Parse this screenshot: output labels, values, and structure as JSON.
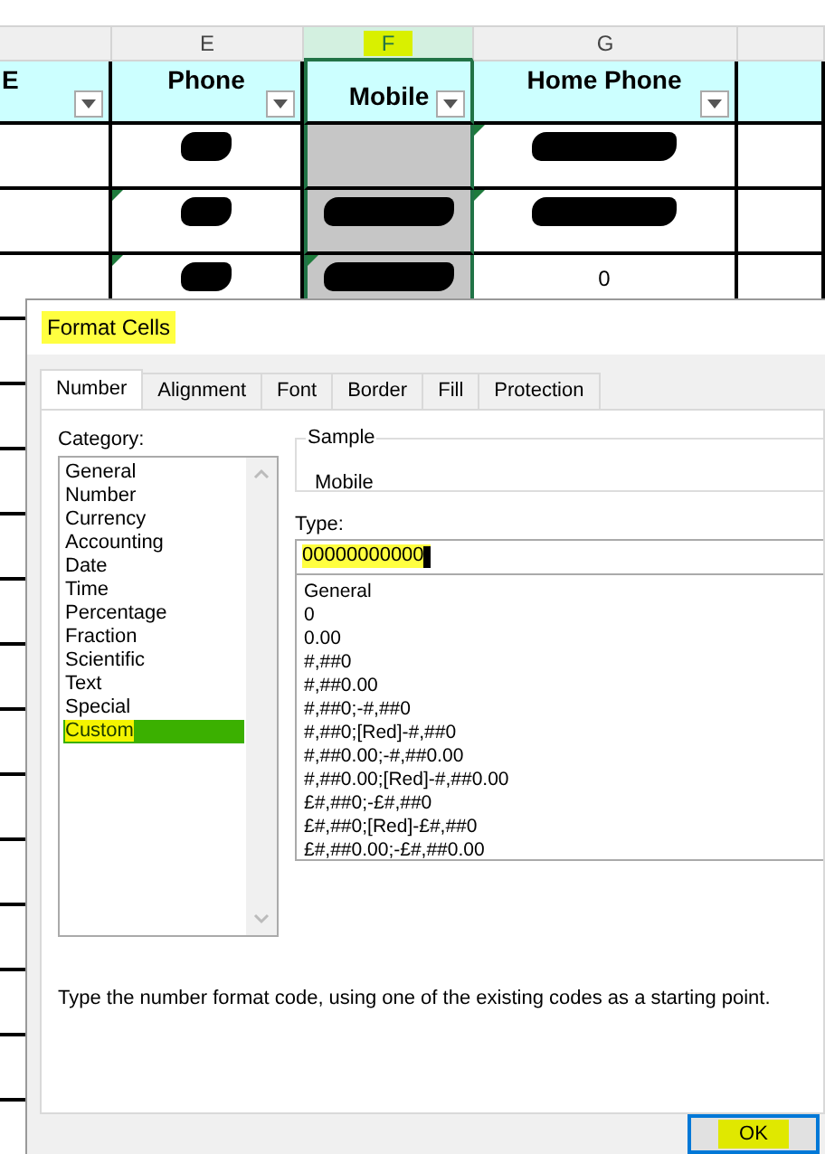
{
  "sheet": {
    "columns": [
      {
        "heading": "E",
        "filter": true,
        "selected": false
      },
      {
        "letter": "E",
        "heading": "Phone",
        "filter": true,
        "selected": false
      },
      {
        "letter": "F",
        "heading": "Mobile",
        "filter": true,
        "selected": true,
        "highlighted": true
      },
      {
        "letter": "G",
        "heading": "Home Phone",
        "filter": true,
        "selected": false
      },
      {
        "filter": false,
        "selected": false
      }
    ],
    "rows": [
      [
        {},
        {
          "redacted": true
        },
        {},
        {
          "redacted": true,
          "flag": true
        },
        {}
      ],
      [
        {},
        {
          "redacted": true,
          "flag": true
        },
        {
          "redacted": true
        },
        {
          "redacted": true,
          "flag": true
        },
        {}
      ],
      [
        {},
        {
          "redacted": true,
          "flag": true
        },
        {
          "redacted": true,
          "flag": true
        },
        {
          "text": "0"
        },
        {}
      ]
    ]
  },
  "dialog": {
    "title": "Format Cells",
    "title_highlighted": true,
    "tabs": [
      {
        "label": "Number",
        "selected": true
      },
      {
        "label": "Alignment",
        "selected": false
      },
      {
        "label": "Font",
        "selected": false
      },
      {
        "label": "Border",
        "selected": false
      },
      {
        "label": "Fill",
        "selected": false
      },
      {
        "label": "Protection",
        "selected": false
      }
    ],
    "category_label": "Category:",
    "categories": [
      {
        "label": "General",
        "selected": false
      },
      {
        "label": "Number",
        "selected": false
      },
      {
        "label": "Currency",
        "selected": false
      },
      {
        "label": "Accounting",
        "selected": false
      },
      {
        "label": "Date",
        "selected": false
      },
      {
        "label": "Time",
        "selected": false
      },
      {
        "label": "Percentage",
        "selected": false
      },
      {
        "label": "Fraction",
        "selected": false
      },
      {
        "label": "Scientific",
        "selected": false
      },
      {
        "label": "Text",
        "selected": false
      },
      {
        "label": "Special",
        "selected": false
      },
      {
        "label": "Custom",
        "selected": true,
        "highlighted": true
      }
    ],
    "sample": {
      "label": "Sample",
      "value": "Mobile"
    },
    "type": {
      "label": "Type:",
      "value": "00000000000",
      "highlighted": true
    },
    "formats": [
      "General",
      "0",
      "0.00",
      "#,##0",
      "#,##0.00",
      "#,##0;-#,##0",
      "#,##0;[Red]-#,##0",
      "#,##0.00;-#,##0.00",
      "#,##0.00;[Red]-#,##0.00",
      "£#,##0;-£#,##0",
      "£#,##0;[Red]-£#,##0",
      "£#,##0.00;-£#,##0.00"
    ],
    "description": "Type the number format code, using one of the existing codes as a starting point.",
    "ok": {
      "label": "OK",
      "highlighted": true
    }
  }
}
